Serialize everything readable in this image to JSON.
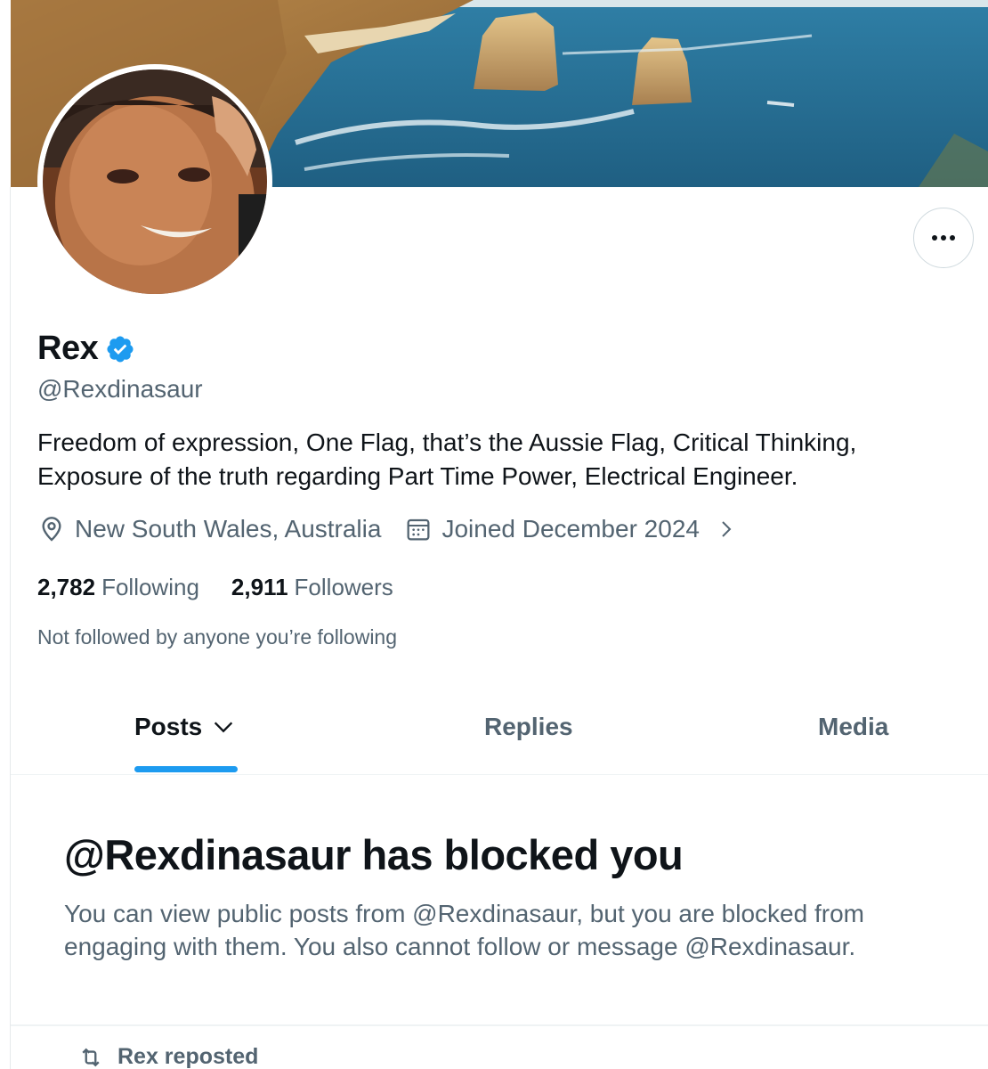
{
  "profile": {
    "name": "Rex",
    "handle": "@Rexdinasaur",
    "bio": "Freedom of expression, One Flag, that’s the Aussie Flag, Critical Thinking, Exposure of the truth regarding Part Time Power, Electrical Engineer.",
    "location": "New South Wales, Australia",
    "joined": "Joined December 2024",
    "following_count": "2,782",
    "following_label": "Following",
    "followers_count": "2,911",
    "followers_label": "Followers",
    "followed_by": "Not followed by anyone you’re following"
  },
  "tabs": [
    {
      "label": "Posts"
    },
    {
      "label": "Replies"
    },
    {
      "label": "Media"
    }
  ],
  "blocked": {
    "title": "@Rexdinasaur has blocked you",
    "description": "You can view public posts from @Rexdinasaur, but you are blocked from engaging with them. You also cannot follow or message @Rexdinasaur."
  },
  "timeline": {
    "repost_label": "Rex reposted"
  },
  "icons": {
    "more": "more-horizontal-icon",
    "verified": "verified-badge-icon",
    "location": "location-pin-icon",
    "calendar": "calendar-icon",
    "chevron_right": "chevron-right-icon",
    "chevron_down": "chevron-down-icon",
    "repost": "repost-icon"
  },
  "colors": {
    "accent": "#1d9bf0",
    "text_primary": "#0f1419",
    "text_secondary": "#536471",
    "border": "#eff3f4"
  }
}
